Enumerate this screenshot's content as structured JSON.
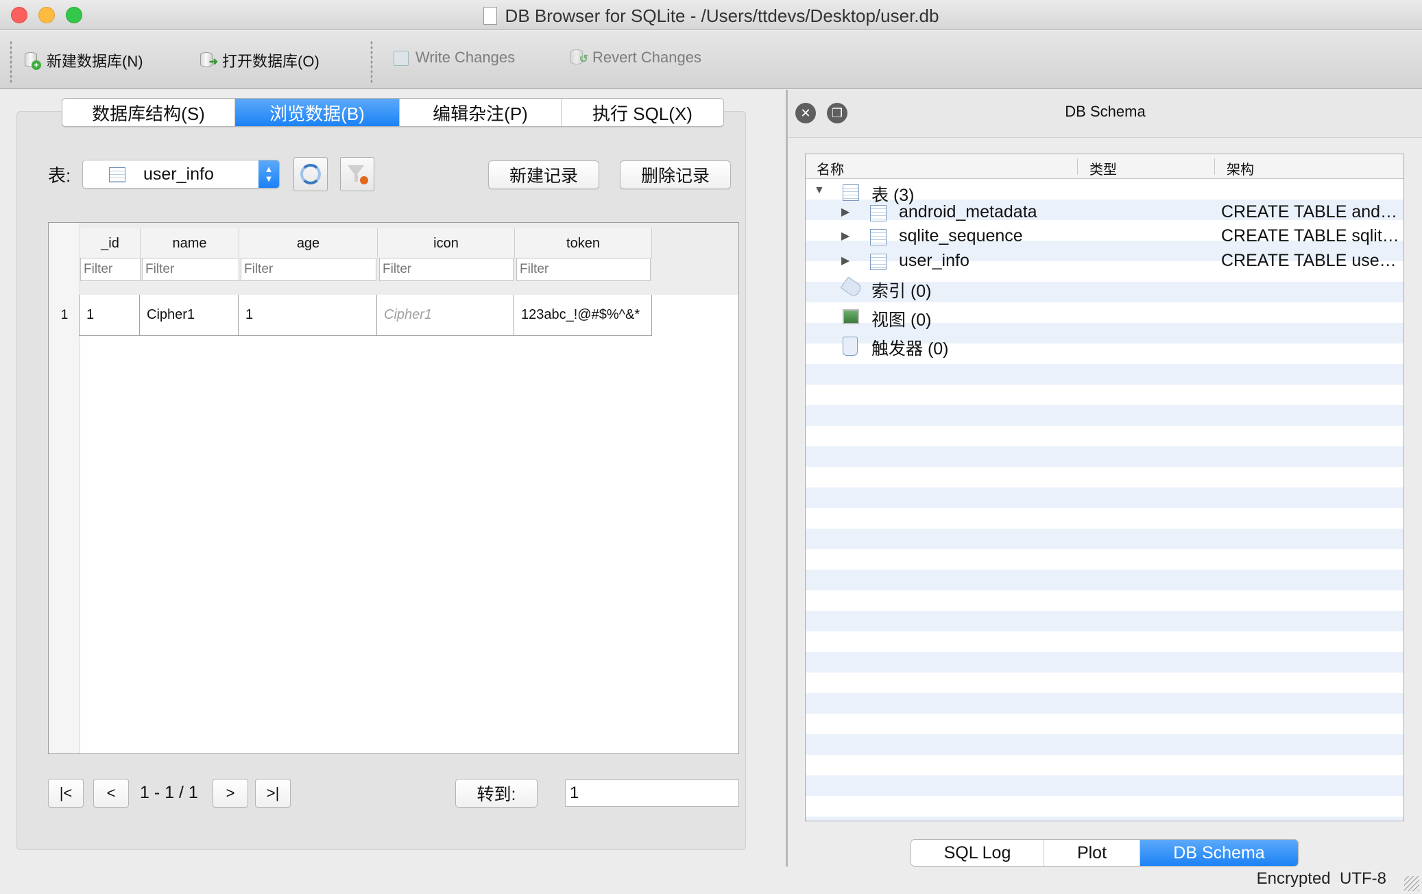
{
  "window": {
    "title": "DB Browser for SQLite - /Users/ttdevs/Desktop/user.db"
  },
  "toolbar": {
    "new_db": "新建数据库(N)",
    "open_db": "打开数据库(O)",
    "write_changes": "Write Changes",
    "revert_changes": "Revert Changes"
  },
  "tabs": [
    "数据库结构(S)",
    "浏览数据(B)",
    "编辑杂注(P)",
    "执行 SQL(X)"
  ],
  "browse": {
    "table_label": "表:",
    "selected_table": "user_info",
    "new_record": "新建记录",
    "delete_record": "删除记录",
    "columns": [
      "_id",
      "name",
      "age",
      "icon",
      "token"
    ],
    "filter_placeholder": "Filter",
    "rows": [
      {
        "rownum": "1",
        "cells": [
          "1",
          "Cipher1",
          "1",
          "Cipher1",
          "123abc_!@#$%^&*"
        ]
      }
    ],
    "nav": {
      "first": "|<",
      "prev": "<",
      "next": ">",
      "last": ">|",
      "page_info": "1 - 1 / 1",
      "goto_label": "转到:",
      "goto_value": "1"
    }
  },
  "schema_dock": {
    "title": "DB Schema",
    "headers": [
      "名称",
      "类型",
      "架构"
    ],
    "tables_group": "表 (3)",
    "tables": [
      {
        "name": "android_metadata",
        "schema": "CREATE TABLE android_metadata (locale TEXT)"
      },
      {
        "name": "sqlite_sequence",
        "schema": "CREATE TABLE sqlite_sequence(name,seq)"
      },
      {
        "name": "user_info",
        "schema": "CREATE TABLE user_info"
      }
    ],
    "indexes_group": "索引 (0)",
    "views_group": "视图 (0)",
    "triggers_group": "触发器 (0)"
  },
  "bottom_tabs": [
    "SQL Log",
    "Plot",
    "DB Schema"
  ],
  "status": {
    "encryption": "Encrypted",
    "encoding": "UTF-8"
  }
}
